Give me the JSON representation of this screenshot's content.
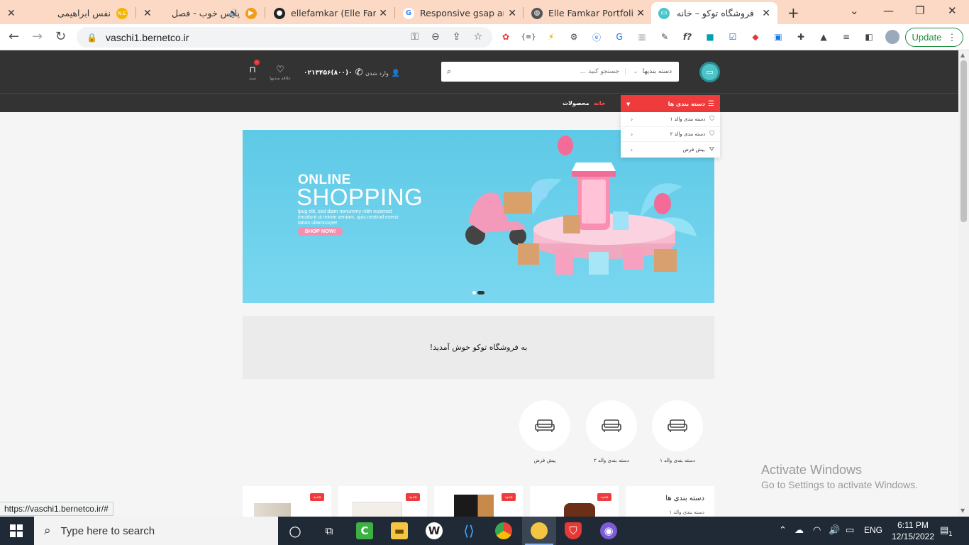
{
  "browser": {
    "tabs": [
      {
        "title": "نفس ابراهیمی",
        "favicon_color": "#f4b400",
        "favicon_glyph": "N.E"
      },
      {
        "title": "پلیس خوب - فصل",
        "favicon_color": "#f59b1a",
        "favicon_glyph": "▶"
      },
      {
        "title": "ellefamkar (Elle Famkar)",
        "favicon_color": "#222222",
        "favicon_glyph": "●"
      },
      {
        "title": "Responsive gsap anim",
        "favicon_color": "#4285f4",
        "favicon_glyph": "G"
      },
      {
        "title": "Elle Famkar Portfolio |",
        "favicon_color": "#555555",
        "favicon_glyph": "◍"
      },
      {
        "title": "فروشگاه توکو – خانه",
        "favicon_color": "#4cc4c8",
        "favicon_glyph": "▭"
      }
    ],
    "url": "vaschi1.bernetco.ir",
    "update_label": "Update",
    "status_url": "https://vaschi1.bernetco.ir/#"
  },
  "site": {
    "search_category": "دسته بندیها",
    "search_placeholder": "جستجو کنید ...",
    "login_label": "وارد شدن",
    "phone": "۰۲۱۳۴۵۶(۸۰۰)۰",
    "favorites_label": "علاقه مندیها",
    "cart_label": "سبد",
    "cart_count": "۰",
    "nav": {
      "categories_button": "دسته بندی ها",
      "home": "خانه",
      "products": "محصولات"
    },
    "dropdown": [
      {
        "label": "دسته بندی والد ۱"
      },
      {
        "label": "دسته بندی والد ۲"
      },
      {
        "label": "پیش فرض"
      }
    ],
    "banner": {
      "line1": "ONLINE",
      "line2": "SHOPPING",
      "body": "lpug elit, sed diam nonummy nibh euismod tincidunt ut minim veniam, quis nostrud exerci tation ullamcorper",
      "cta": "SHOP NOW!",
      "bg": "#6fd1ec"
    },
    "welcome": "به فروشگاه توکو خوش آمدید!",
    "categories": [
      {
        "label": "دسته بندی والد ۱"
      },
      {
        "label": "دسته بندی والد ۲"
      },
      {
        "label": "پیش فرض"
      }
    ],
    "product_badge": "جدید",
    "side_categories_title": "دسته بندی ها",
    "side_categories_first": "دسته بندی والد ۱"
  },
  "windows": {
    "activate_title": "Activate Windows",
    "activate_sub": "Go to Settings to activate Windows.",
    "search_placeholder": "Type here to search",
    "lang": "ENG",
    "time": "6:11 PM",
    "date": "12/15/2022",
    "notifications": "1"
  },
  "colors": {
    "accent_red": "#ef3b3b",
    "header_dark": "#333333",
    "logo_teal": "#4cc4c8"
  }
}
